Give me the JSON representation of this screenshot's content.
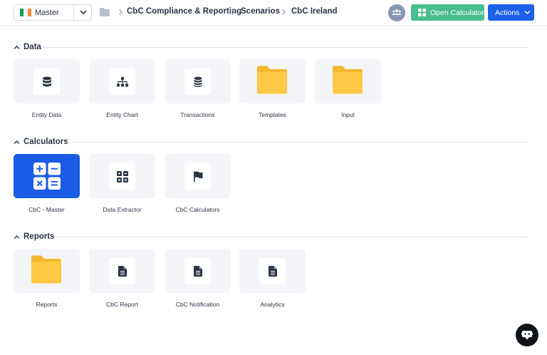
{
  "topbar": {
    "entity": {
      "label": "Master",
      "flag_colors": [
        "#169b62",
        "#ffffff",
        "#ff883e"
      ]
    },
    "breadcrumb": [
      "CbC Compliance & Reporting",
      "Scenarios",
      "CbC Ireland"
    ],
    "open_calculator_label": "Open Calculator",
    "actions_label": "Actions"
  },
  "sections": {
    "data": {
      "title": "Data",
      "tiles": [
        {
          "label": "Entity Data",
          "icon": "database-icon"
        },
        {
          "label": "Entity Chart",
          "icon": "org-chart-icon"
        },
        {
          "label": "Transactions",
          "icon": "coins-icon"
        },
        {
          "label": "Templates",
          "icon": "folder-icon"
        },
        {
          "label": "Input",
          "icon": "folder-icon"
        }
      ]
    },
    "calculators": {
      "title": "Calculators",
      "tiles": [
        {
          "label": "CbC - Master",
          "icon": "calculator-icon"
        },
        {
          "label": "Data Extractor",
          "icon": "calculator-icon"
        },
        {
          "label": "CbC Calculators",
          "icon": "flag-icon"
        }
      ]
    },
    "reports": {
      "title": "Reports",
      "tiles": [
        {
          "label": "Reports",
          "icon": "folder-icon"
        },
        {
          "label": "CbC Report",
          "icon": "document-icon"
        },
        {
          "label": "CbC Notification",
          "icon": "document-icon"
        },
        {
          "label": "Analytics",
          "icon": "document-icon"
        }
      ]
    }
  },
  "colors": {
    "primary": "#1c61e8",
    "success": "#49bd8f",
    "folder": "#ffc845",
    "tile_bg": "#f4f5f8",
    "text": "#2b3445"
  }
}
